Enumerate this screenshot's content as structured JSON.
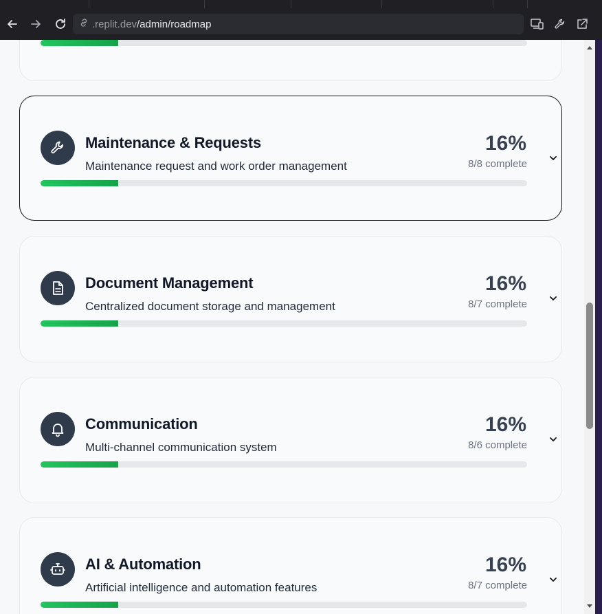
{
  "browser": {
    "url_host": ".replit.dev",
    "url_path": "/admin/roadmap",
    "icons": [
      "back-arrow-icon",
      "forward-arrow-icon",
      "reload-icon",
      "link-icon",
      "device-icon",
      "wrench-icon",
      "external-link-icon"
    ]
  },
  "cards": [
    {
      "title": "Maintenance & Requests",
      "description": "Maintenance request and work order management",
      "percent": "16%",
      "count": "8/8 complete",
      "progress": 0.16,
      "icon": "wrench-icon"
    },
    {
      "title": "Document Management",
      "description": "Centralized document storage and management",
      "percent": "16%",
      "count": "8/7 complete",
      "progress": 0.16,
      "icon": "document-icon"
    },
    {
      "title": "Communication",
      "description": "Multi-channel communication system",
      "percent": "16%",
      "count": "8/6 complete",
      "progress": 0.16,
      "icon": "bell-icon"
    },
    {
      "title": "AI & Automation",
      "description": "Artificial intelligence and automation features",
      "percent": "16%",
      "count": "8/7 complete",
      "progress": 0.16,
      "icon": "robot-icon"
    }
  ],
  "colors": {
    "progress_fill": "#22c55e",
    "icon_bg": "#2f3a4b"
  }
}
